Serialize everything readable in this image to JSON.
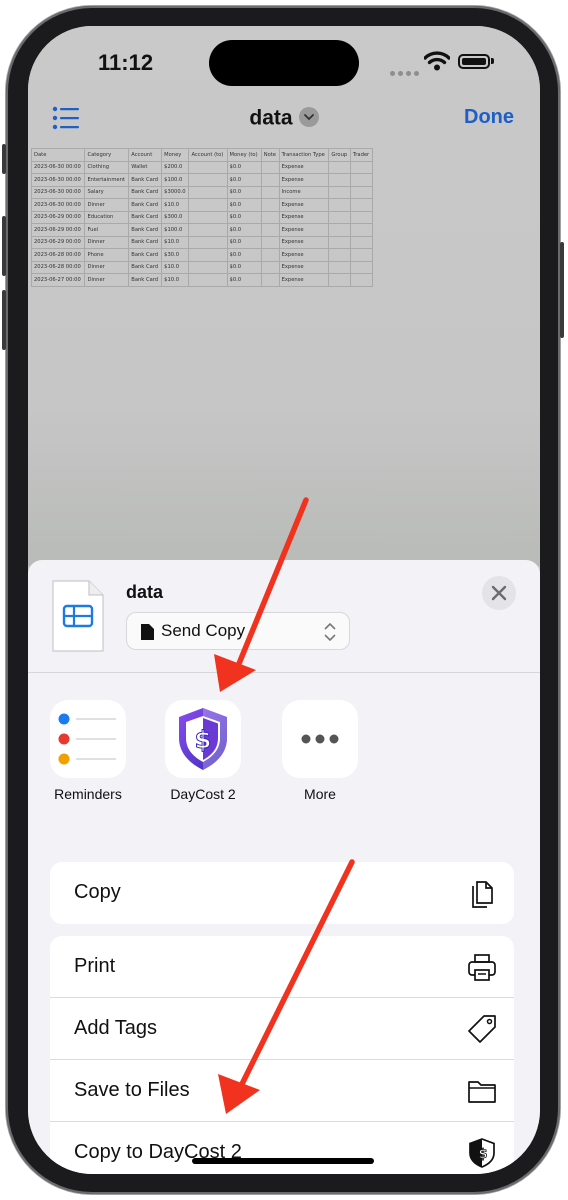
{
  "status_bar": {
    "time": "11:12"
  },
  "nav": {
    "title": "data",
    "done_label": "Done"
  },
  "spreadsheet": {
    "headers": [
      "Date",
      "Category",
      "Account",
      "Money",
      "Account (to)",
      "Money (to)",
      "Note",
      "Transaction Type",
      "Group",
      "Trader"
    ],
    "rows": [
      [
        "2023-06-30 00:00",
        "Clothing",
        "Wallet",
        "$200.0",
        "",
        "$0.0",
        "",
        "Expense",
        "",
        ""
      ],
      [
        "2023-06-30 00:00",
        "Entertainment",
        "Bank Card",
        "$100.0",
        "",
        "$0.0",
        "",
        "Expense",
        "",
        ""
      ],
      [
        "2023-06-30 00:00",
        "Salary",
        "Bank Card",
        "$3000.0",
        "",
        "$0.0",
        "",
        "Income",
        "",
        ""
      ],
      [
        "2023-06-30 00:00",
        "Dinner",
        "Bank Card",
        "$10.0",
        "",
        "$0.0",
        "",
        "Expense",
        "",
        ""
      ],
      [
        "2023-06-29 00:00",
        "Education",
        "Bank Card",
        "$300.0",
        "",
        "$0.0",
        "",
        "Expense",
        "",
        ""
      ],
      [
        "2023-06-29 00:00",
        "Fuel",
        "Bank Card",
        "$100.0",
        "",
        "$0.0",
        "",
        "Expense",
        "",
        ""
      ],
      [
        "2023-06-29 00:00",
        "Dinner",
        "Bank Card",
        "$10.0",
        "",
        "$0.0",
        "",
        "Expense",
        "",
        ""
      ],
      [
        "2023-06-28 00:00",
        "Phone",
        "Bank Card",
        "$30.0",
        "",
        "$0.0",
        "",
        "Expense",
        "",
        ""
      ],
      [
        "2023-06-28 00:00",
        "Dinner",
        "Bank Card",
        "$10.0",
        "",
        "$0.0",
        "",
        "Expense",
        "",
        ""
      ],
      [
        "2023-06-27 00:00",
        "Dinner",
        "Bank Card",
        "$10.0",
        "",
        "$0.0",
        "",
        "Expense",
        "",
        ""
      ]
    ]
  },
  "share_sheet": {
    "file_name": "data",
    "send_mode": "Send Copy",
    "apps": [
      {
        "label": "Reminders",
        "icon": "reminders-icon"
      },
      {
        "label": "DayCost 2",
        "icon": "daycost-shield-icon"
      },
      {
        "label": "More",
        "icon": "more-icon"
      }
    ],
    "copy_label": "Copy",
    "actions": [
      {
        "label": "Print",
        "icon": "printer-icon"
      },
      {
        "label": "Add Tags",
        "icon": "tag-icon"
      },
      {
        "label": "Save to Files",
        "icon": "folder-icon"
      },
      {
        "label": "Copy to DayCost 2",
        "icon": "daycost-shield-icon"
      }
    ]
  },
  "colors": {
    "accent": "#1d5fc7",
    "arrow": "#f0321e",
    "brand_purple": "#6b3ad6"
  }
}
